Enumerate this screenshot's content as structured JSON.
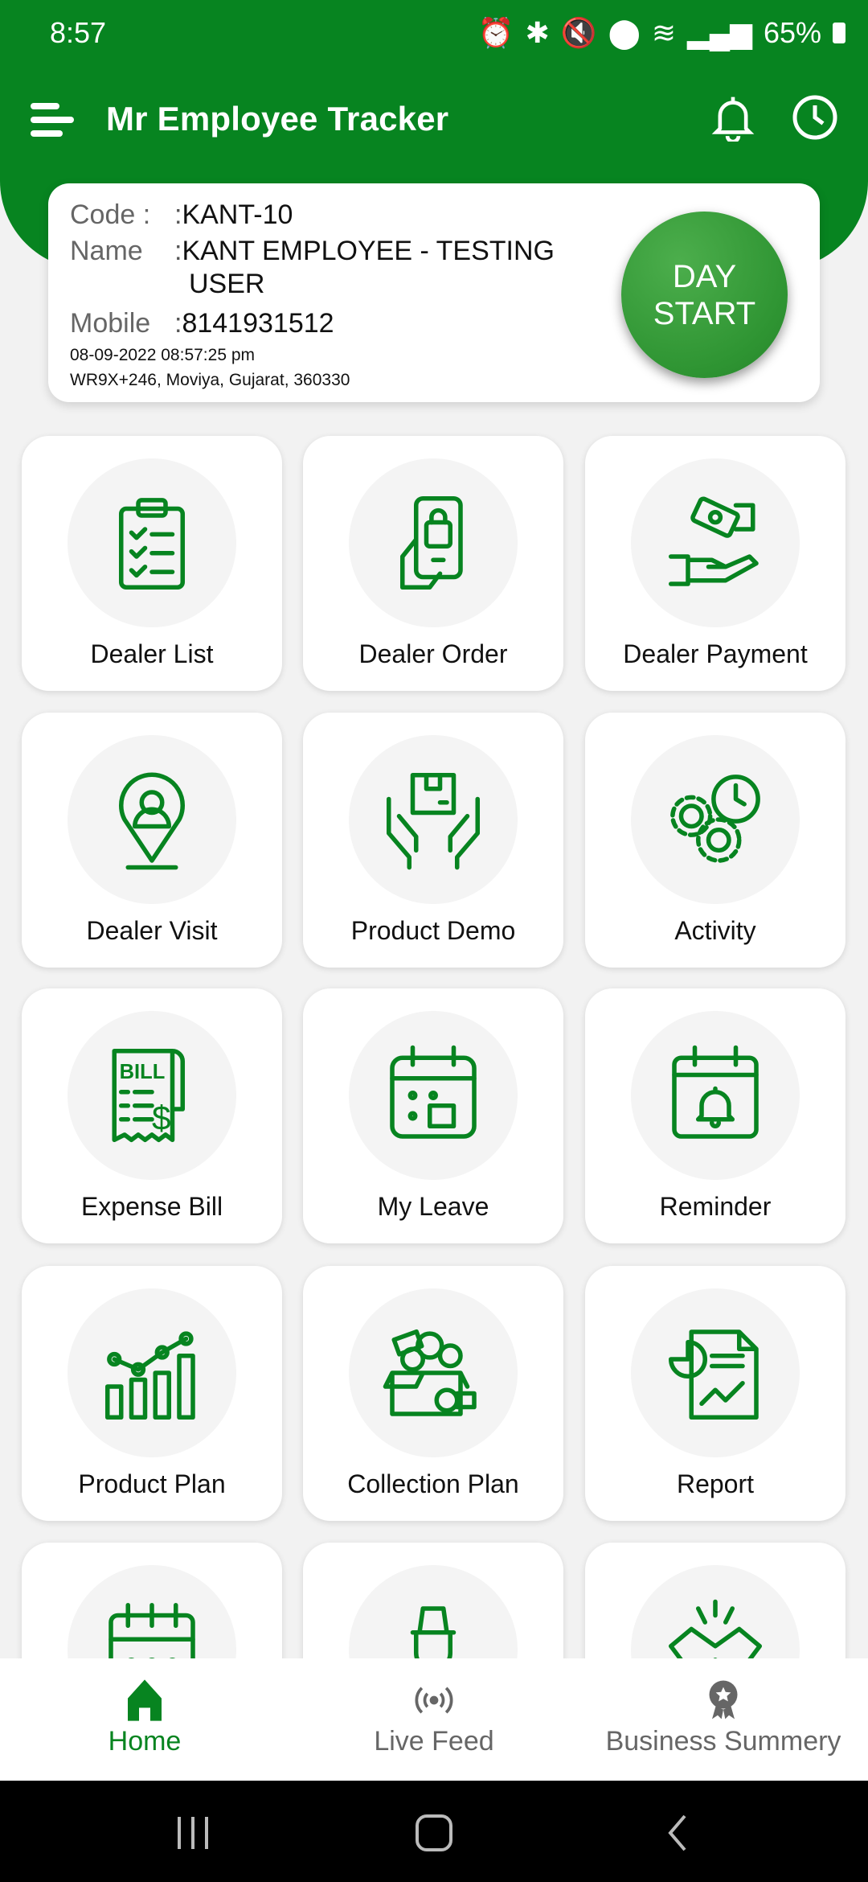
{
  "status_bar": {
    "time": "8:57",
    "battery": "65%"
  },
  "app_bar": {
    "title": "Mr Employee Tracker"
  },
  "profile": {
    "code_label": "Code :",
    "code": "KANT-10",
    "name_label": "Name",
    "name_line1": "KANT EMPLOYEE - TESTING",
    "name_line2": "USER",
    "mobile_label": "Mobile",
    "mobile": "8141931512",
    "separator": ":",
    "datetime": "08-09-2022 08:57:25 pm",
    "address": "WR9X+246, Moviya, Gujarat, 360330",
    "day_button_line1": "DAY",
    "day_button_line2": "START"
  },
  "colors": {
    "brand": "#078420",
    "inactive": "#666666"
  },
  "tiles": [
    {
      "label": "Dealer List",
      "icon": "clipboard-checklist-icon"
    },
    {
      "label": "Dealer Order",
      "icon": "phone-shopping-bag-icon"
    },
    {
      "label": "Dealer Payment",
      "icon": "hand-money-icon"
    },
    {
      "label": "Dealer Visit",
      "icon": "location-pin-user-icon"
    },
    {
      "label": "Product Demo",
      "icon": "hands-box-icon"
    },
    {
      "label": "Activity",
      "icon": "gears-clock-icon"
    },
    {
      "label": "Expense Bill",
      "icon": "bill-receipt-icon"
    },
    {
      "label": "My Leave",
      "icon": "calendar-square-icon"
    },
    {
      "label": "Reminder",
      "icon": "calendar-bell-icon"
    },
    {
      "label": "Product Plan",
      "icon": "bar-chart-trend-icon"
    },
    {
      "label": "Collection Plan",
      "icon": "money-box-icon"
    },
    {
      "label": "Report",
      "icon": "report-document-icon"
    },
    {
      "label": "",
      "icon": "calendar-dots-icon"
    },
    {
      "label": "",
      "icon": "person-hat-icon"
    },
    {
      "label": "",
      "icon": "handshake-icon"
    }
  ],
  "bottom_nav": [
    {
      "label": "Home",
      "icon": "home-icon",
      "active": true
    },
    {
      "label": "Live Feed",
      "icon": "broadcast-icon",
      "active": false
    },
    {
      "label": "Business Summery",
      "icon": "award-badge-icon",
      "active": false
    }
  ]
}
